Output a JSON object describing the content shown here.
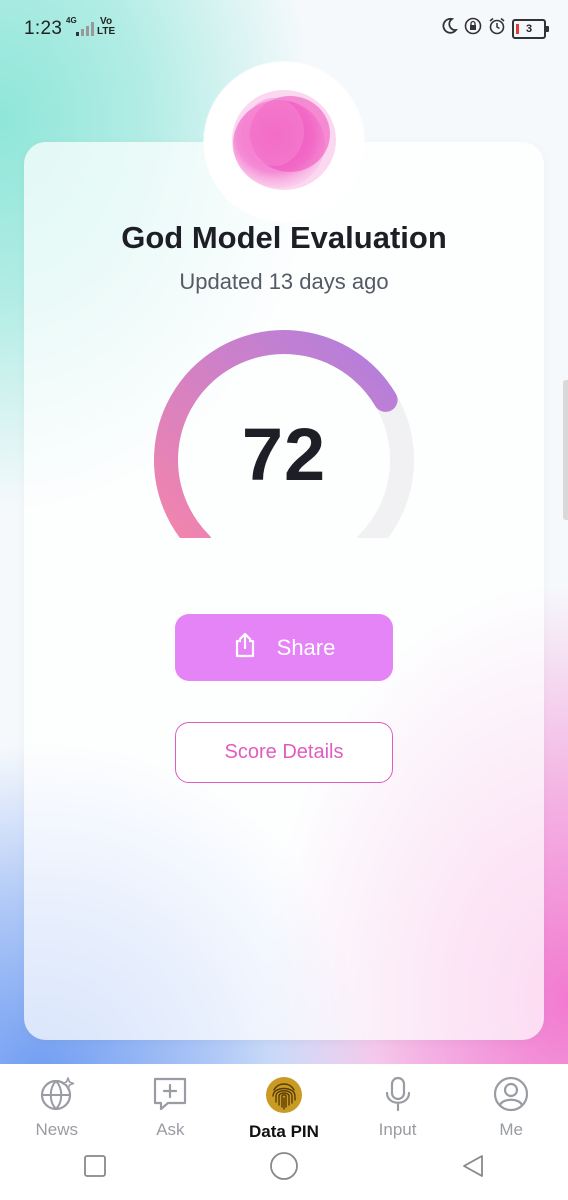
{
  "status_bar": {
    "time": "1:23",
    "network": "4G",
    "volte_top": "Vo",
    "volte_bottom": "LTE",
    "battery": "3",
    "icons": [
      "moon-icon",
      "lock-rotation-icon",
      "alarm-icon",
      "battery-icon"
    ]
  },
  "evaluation": {
    "title": "God Model Evaluation",
    "updated": "Updated 13 days ago",
    "score": "72",
    "score_fraction": 0.72,
    "gauge_colors": [
      "#f484ab",
      "#b17ede"
    ]
  },
  "actions": {
    "share_label": "Share",
    "details_label": "Score Details"
  },
  "nav": {
    "items": [
      {
        "label": "News",
        "icon": "globe-sparkle-icon"
      },
      {
        "label": "Ask",
        "icon": "chat-plus-icon"
      },
      {
        "label": "Data PIN",
        "icon": "fingerprint-icon"
      },
      {
        "label": "Input",
        "icon": "microphone-icon"
      },
      {
        "label": "Me",
        "icon": "user-icon"
      }
    ],
    "active": "Data PIN"
  },
  "colors": {
    "accent": "#e584f7",
    "outline_pink": "#e15cbf",
    "fingerprint_gold": "#c99a24"
  }
}
